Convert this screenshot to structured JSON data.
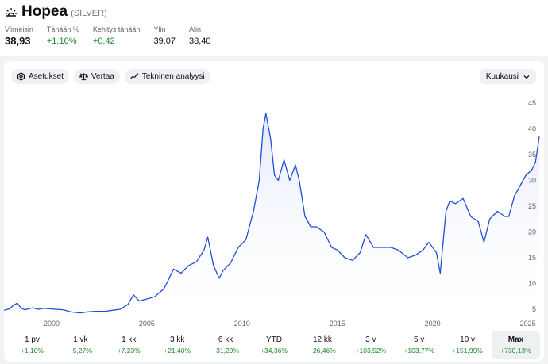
{
  "header": {
    "title": "Hopea",
    "ticker": "(SILVER)",
    "icon": "sunrise-icon",
    "stats": [
      {
        "label": "Viimeisin",
        "value": "38,93",
        "style": "big"
      },
      {
        "label": "Tänään %",
        "value": "+1,10%",
        "style": "green"
      },
      {
        "label": "Kehitys tänään",
        "value": "+0,42",
        "style": "green"
      },
      {
        "label": "Ylin",
        "value": "39,07",
        "style": ""
      },
      {
        "label": "Alin",
        "value": "38,40",
        "style": ""
      }
    ]
  },
  "toolbar": {
    "settings_label": "Asetukset",
    "compare_label": "Vertaa",
    "technical_label": "Tekninen analyysi",
    "period_select": "Kuukausi"
  },
  "colors": {
    "line": "#1f4fd6",
    "positive": "#1b8a2a",
    "fill_top": "#dfe6fb"
  },
  "chart_data": {
    "type": "area",
    "x_ticks": [
      "2000",
      "2005",
      "2010",
      "2015",
      "2020",
      "2025"
    ],
    "y_ticks": [
      5,
      10,
      15,
      20,
      25,
      30,
      35,
      40,
      45
    ],
    "ylim": [
      3,
      47
    ],
    "xlim": [
      1997.5,
      2025.6
    ],
    "grid": false,
    "x": [
      1997.5,
      1997.8,
      1998.0,
      1998.2,
      1998.4,
      1998.6,
      1998.8,
      1999.0,
      1999.3,
      1999.6,
      1999.9,
      2000.2,
      2000.6,
      2001.0,
      2001.5,
      2001.9,
      2002.3,
      2002.8,
      2003.2,
      2003.6,
      2004.0,
      2004.3,
      2004.6,
      2005.0,
      2005.4,
      2005.9,
      2006.1,
      2006.4,
      2006.8,
      2007.2,
      2007.6,
      2008.0,
      2008.2,
      2008.5,
      2008.8,
      2009.0,
      2009.4,
      2009.8,
      2010.2,
      2010.6,
      2010.9,
      2011.1,
      2011.25,
      2011.5,
      2011.7,
      2011.9,
      2012.2,
      2012.5,
      2012.8,
      2013.0,
      2013.3,
      2013.6,
      2013.9,
      2014.3,
      2014.7,
      2015.0,
      2015.4,
      2015.8,
      2016.2,
      2016.5,
      2016.9,
      2017.3,
      2017.8,
      2018.2,
      2018.7,
      2019.1,
      2019.5,
      2019.8,
      2020.2,
      2020.4,
      2020.7,
      2020.9,
      2021.2,
      2021.6,
      2022.0,
      2022.4,
      2022.7,
      2023.0,
      2023.4,
      2023.8,
      2024.0,
      2024.3,
      2024.6,
      2024.9,
      2025.2,
      2025.4,
      2025.6
    ],
    "values": [
      4.8,
      5.1,
      5.8,
      6.2,
      5.2,
      4.9,
      5.1,
      5.3,
      5.0,
      5.2,
      5.1,
      5.0,
      4.9,
      4.5,
      4.3,
      4.5,
      4.6,
      4.6,
      4.8,
      5.0,
      5.9,
      7.8,
      6.6,
      7.0,
      7.4,
      9.0,
      10.5,
      12.8,
      12.0,
      13.5,
      14.2,
      16.5,
      19.0,
      13.5,
      11.0,
      12.5,
      14.0,
      17.0,
      18.5,
      24.0,
      30.0,
      40.0,
      43.0,
      38.0,
      31.0,
      30.0,
      34.0,
      30.0,
      33.0,
      30.0,
      23.0,
      21.0,
      21.0,
      20.0,
      17.0,
      16.5,
      15.0,
      14.5,
      16.0,
      19.5,
      17.0,
      17.0,
      17.0,
      16.5,
      15.0,
      15.5,
      16.5,
      18.0,
      16.0,
      12.0,
      24.0,
      26.0,
      25.5,
      26.5,
      23.0,
      22.0,
      18.0,
      22.5,
      24.0,
      23.0,
      23.0,
      27.0,
      29.0,
      31.0,
      32.0,
      33.5,
      38.5
    ]
  },
  "ranges": [
    {
      "label": "1 pv",
      "change": "+1,10%"
    },
    {
      "label": "1 vk",
      "change": "+5,27%"
    },
    {
      "label": "1 kk",
      "change": "+7,23%"
    },
    {
      "label": "3 kk",
      "change": "+21,40%"
    },
    {
      "label": "6 kk",
      "change": "+31,20%"
    },
    {
      "label": "YTD",
      "change": "+34,36%"
    },
    {
      "label": "12 kk",
      "change": "+26,46%"
    },
    {
      "label": "3 v",
      "change": "+103,52%"
    },
    {
      "label": "5 v",
      "change": "+103,77%"
    },
    {
      "label": "10 v",
      "change": "+151,99%"
    },
    {
      "label": "Max",
      "change": "+730,13%",
      "active": true
    }
  ]
}
